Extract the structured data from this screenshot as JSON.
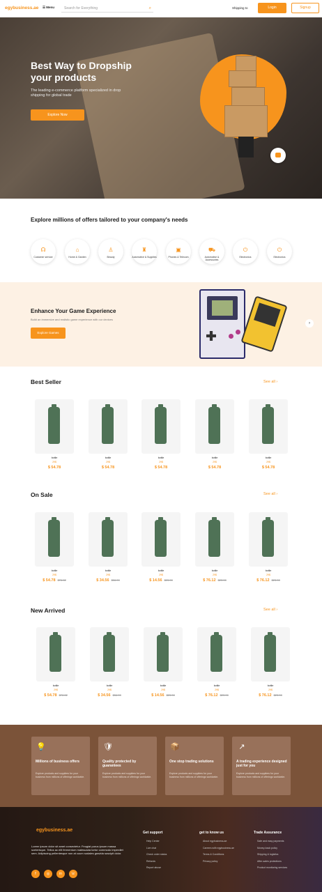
{
  "header": {
    "logo": "egybusiness.ae",
    "categories": "☰ Menu",
    "search_placeholder": "Search for Everything",
    "lang": "Shipping to",
    "login": "Login",
    "signup": "Signup"
  },
  "hero": {
    "title": "Best Way to Dropship your products",
    "subtitle": "The leading e-commerce platform specialized in drop shipping for global trade",
    "button": "Explore Now"
  },
  "categories": {
    "title": "Explore millions of offers tailored to your company's needs",
    "items": [
      {
        "label": "Customer service",
        "icon": "headset-icon"
      },
      {
        "label": "Home & Garden",
        "icon": "home-icon"
      },
      {
        "label": "Beauty",
        "icon": "bottle-icon"
      },
      {
        "label": "Automotive & Supplies",
        "icon": "bag-icon"
      },
      {
        "label": "Phones & Telecom",
        "icon": "robot-icon"
      },
      {
        "label": "Automotive & Accessories",
        "icon": "car-icon"
      },
      {
        "label": "Electronics",
        "icon": "power-icon"
      },
      {
        "label": "Electronics",
        "icon": "power-icon"
      }
    ]
  },
  "game": {
    "title": "Enhance Your Game Experience",
    "subtitle": "Build an immersive and realistic game experience with our devices",
    "button": "Explore Games"
  },
  "see_all": "See all",
  "best": {
    "title": "Best Seller",
    "items": [
      {
        "name": "bottle",
        "qty": "29$",
        "price": "$ 54.78"
      },
      {
        "name": "bottle",
        "qty": "29$",
        "price": "$ 54.78"
      },
      {
        "name": "bottle",
        "qty": "29$",
        "price": "$ 54.78"
      },
      {
        "name": "bottle",
        "qty": "29$",
        "price": "$ 54.78"
      },
      {
        "name": "bottle",
        "qty": "29$",
        "price": "$ 54.78"
      }
    ]
  },
  "sale": {
    "title": "On Sale",
    "items": [
      {
        "name": "bottle",
        "qty": "29$",
        "price": "$ 54.78",
        "old": "$76.82"
      },
      {
        "name": "bottle",
        "qty": "29$",
        "price": "$ 34.56",
        "old": "$56.09"
      },
      {
        "name": "bottle",
        "qty": "29$",
        "price": "$ 14.56",
        "old": "$23.00"
      },
      {
        "name": "bottle",
        "qty": "29$",
        "price": "$ 76.12",
        "old": "$23.00"
      },
      {
        "name": "bottle",
        "qty": "29$",
        "price": "$ 76.12",
        "old": "$23.00"
      }
    ]
  },
  "arrived": {
    "title": "New Arrived",
    "items": [
      {
        "name": "bottle",
        "qty": "29$",
        "price": "$ 54.78",
        "old": "$76.82"
      },
      {
        "name": "bottle",
        "qty": "29$",
        "price": "$ 34.56",
        "old": "$56.09"
      },
      {
        "name": "bottle",
        "qty": "29$",
        "price": "$ 14.56",
        "old": "$23.00"
      },
      {
        "name": "bottle",
        "qty": "29$",
        "price": "$ 76.12",
        "old": "$23.00"
      },
      {
        "name": "bottle",
        "qty": "29$",
        "price": "$ 76.12",
        "old": "$23.00"
      }
    ]
  },
  "features": [
    {
      "title": "Millions of business offers",
      "desc": "Explore products and suppliers for your business from millions of offerings worldwide."
    },
    {
      "title": "Quality protected by guarantees",
      "desc": "Explore products and suppliers for your business from millions of offerings worldwide."
    },
    {
      "title": "One stop trading solutions",
      "desc": "Explore products and suppliers for your business from millions of offerings worldwide."
    },
    {
      "title": "A trading experience designed just for you",
      "desc": "Explore products and suppliers for your business from millions of offerings worldwide."
    }
  ],
  "footer": {
    "logo": "egybusiness.ae",
    "desc": "Lorem ipsum dolor sit amet consectetur. Feugiat purus ipsum massa scelerisque. Tellus ac elit fermentum malesuada tortor commodo imperdiet sem. Adipiscing pellentesque non at cuum sodales gravida suscipit dolor.",
    "cols": [
      {
        "title": "Get support",
        "items": [
          "Help Center",
          "Live chat",
          "Check order status",
          "Refunds",
          "Report abuse"
        ]
      },
      {
        "title": "get to know us",
        "items": [
          "About egybusiness.ae",
          "Careers with egybusiness.ae",
          "Terms & Conditions",
          "Privacy policy"
        ]
      },
      {
        "title": "Trade Assurance",
        "items": [
          "Safe and easy payments",
          "Money-back policy",
          "Shipping & logistics",
          "After-sales protections",
          "Product monitoring services"
        ]
      }
    ]
  }
}
